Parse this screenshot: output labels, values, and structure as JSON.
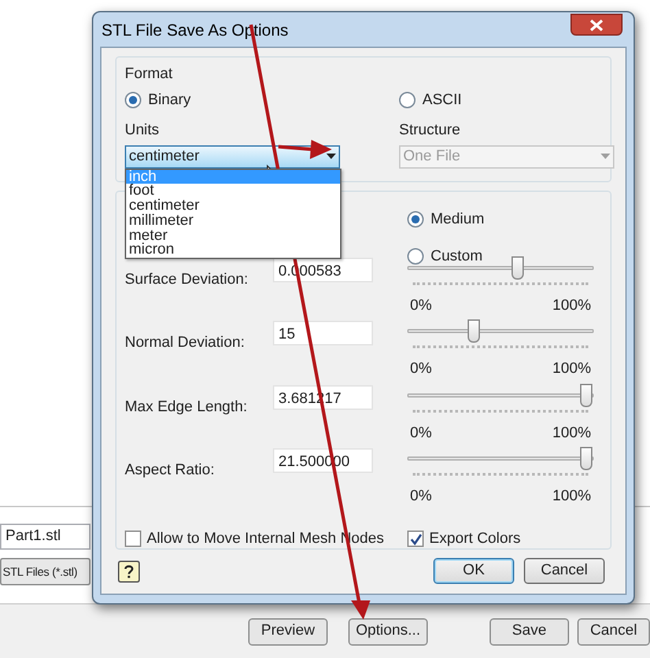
{
  "background_dialog": {
    "file_name": "Part1.stl",
    "file_type": "STL Files (*.stl)",
    "buttons": [
      "Preview",
      "Options...",
      "Save",
      "Cancel"
    ]
  },
  "window": {
    "title": "STL File Save As Options"
  },
  "format": {
    "label": "Format",
    "options": [
      {
        "label": "Binary",
        "selected": true
      },
      {
        "label": "ASCII",
        "selected": false
      }
    ]
  },
  "units": {
    "label": "Units",
    "value": "centimeter",
    "expanded": true,
    "options": [
      {
        "label": "inch",
        "highlighted": true
      },
      {
        "label": "foot",
        "highlighted": false
      },
      {
        "label": "centimeter",
        "highlighted": false
      },
      {
        "label": "millimeter",
        "highlighted": false
      },
      {
        "label": "meter",
        "highlighted": false
      },
      {
        "label": "micron",
        "highlighted": false
      }
    ]
  },
  "structure": {
    "label": "Structure",
    "value": "One File",
    "disabled": true
  },
  "resolution": {
    "options": [
      {
        "label": "Medium",
        "selected": true
      },
      {
        "label": "Custom",
        "selected": false
      }
    ]
  },
  "parameters": [
    {
      "label": "Surface Deviation:",
      "value": "0.000583",
      "level": 0.6,
      "min_label": "0%",
      "max_label": "100%"
    },
    {
      "label": "Normal Deviation:",
      "value": "15",
      "level": 0.35,
      "min_label": "0%",
      "max_label": "100%"
    },
    {
      "label": "Max Edge Length:",
      "value": "3.681217",
      "level": 1,
      "min_label": "0%",
      "max_label": "100%"
    },
    {
      "label": "Aspect Ratio:",
      "value": "21.500000",
      "level": 1,
      "min_label": "0%",
      "max_label": "100%"
    }
  ],
  "checkboxes": [
    {
      "label": "Allow to Move Internal Mesh Nodes",
      "checked": false
    },
    {
      "label": "Export Colors",
      "checked": true
    }
  ],
  "buttons": [
    {
      "label": "OK",
      "default": true
    },
    {
      "label": "Cancel",
      "default": false
    }
  ]
}
